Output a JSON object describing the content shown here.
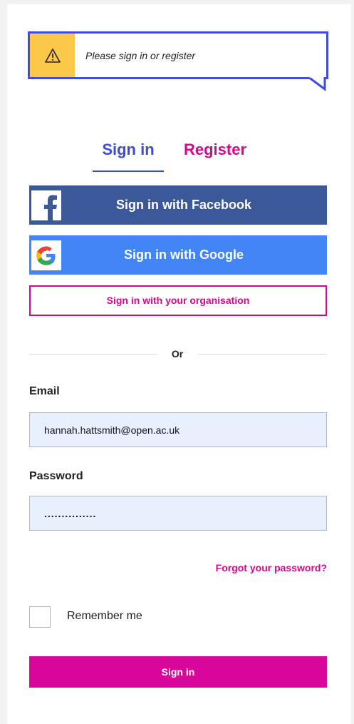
{
  "alert": {
    "message": "Please sign in or register",
    "icon": "warning-icon",
    "border_color": "#3e4ce0",
    "icon_bg": "#fcc84a"
  },
  "tabs": {
    "signin_label": "Sign in",
    "register_label": "Register",
    "active": "Sign in"
  },
  "social": {
    "facebook_label": "Sign in with Facebook",
    "google_label": "Sign in with Google",
    "organisation_label": "Sign in with your organisation"
  },
  "divider": {
    "label": "Or"
  },
  "form": {
    "email_label": "Email",
    "email_value": "hannah.hattsmith@open.ac.uk",
    "password_label": "Password",
    "password_value": "...............",
    "forgot_label": "Forgot your password?",
    "remember_label": "Remember me",
    "remember_checked": false,
    "submit_label": "Sign in"
  },
  "colors": {
    "primary_blue": "#3d4bd6",
    "accent_pink": "#d2088d",
    "facebook": "#3b5998",
    "google": "#4285f4",
    "input_bg": "#e8f0fe"
  }
}
